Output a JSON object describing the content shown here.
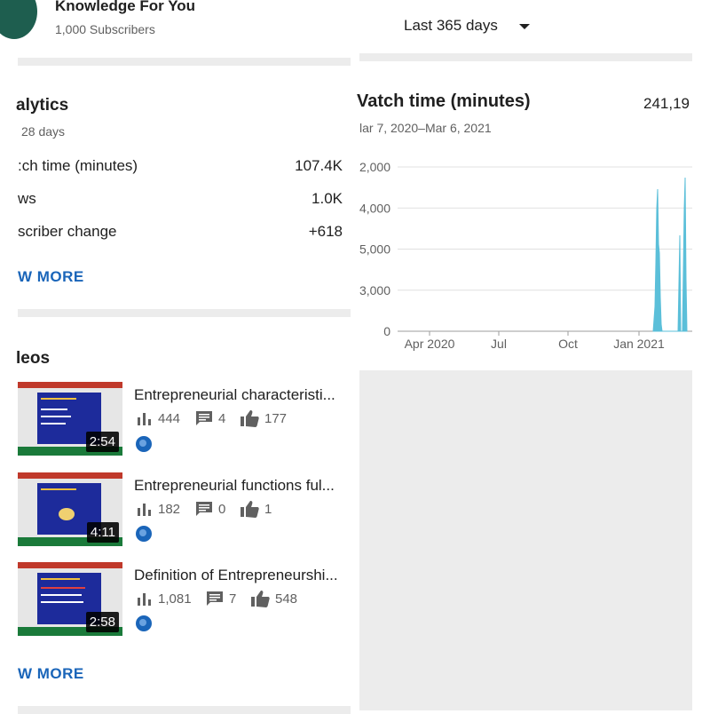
{
  "header": {
    "channel_name": "Knowledge For You",
    "subscribers": "1,000 Subscribers",
    "range_label": "Last 365 days"
  },
  "analytics": {
    "title": "alytics",
    "period": "28 days",
    "metrics": [
      {
        "label": ":ch time (minutes)",
        "value": "107.4K"
      },
      {
        "label": "ws",
        "value": "1.0K"
      },
      {
        "label": "scriber change",
        "value": "+618"
      }
    ],
    "see_more": "W MORE"
  },
  "videos": {
    "title": "leos",
    "items": [
      {
        "title": "Entrepreneurial characteristi...",
        "duration": "2:54",
        "views": "444",
        "comments": "4",
        "likes": "177"
      },
      {
        "title": "Entrepreneurial functions ful...",
        "duration": "4:11",
        "views": "182",
        "comments": "0",
        "likes": "1"
      },
      {
        "title": "Definition of Entrepreneurshi...",
        "duration": "2:58",
        "views": "1,081",
        "comments": "7",
        "likes": "548"
      }
    ],
    "see_more": "W MORE"
  },
  "chart_panel": {
    "title": "Vatch time (minutes)",
    "total": "241,19",
    "date_range": "lar 7, 2020–Mar 6, 2021"
  },
  "chart_data": {
    "type": "area",
    "y_ticks": [
      "2,000",
      "4,000",
      "5,000",
      "3,000",
      "0"
    ],
    "x_ticks": [
      "Apr 2020",
      "Jul",
      "Oct",
      "Jan 2021"
    ],
    "color": "#5bbfd9"
  },
  "colors": {
    "accent": "#1a65b9",
    "avatar": "#1e5e4f",
    "chart": "#5bbfd9"
  },
  "icons": {
    "views": "bar-chart-icon",
    "comments": "comment-icon",
    "likes": "thumbs-up-icon",
    "visibility": "globe-icon"
  }
}
